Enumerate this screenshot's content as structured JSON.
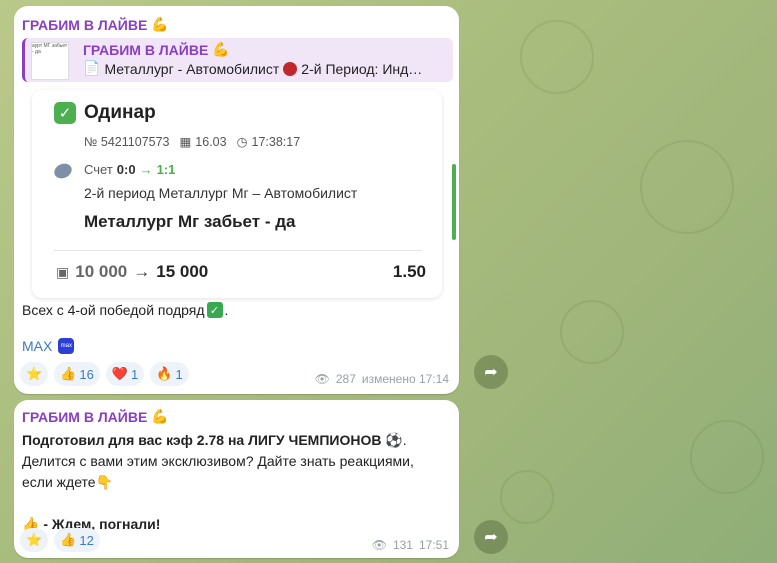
{
  "background": {
    "accent": "#8a3fc2",
    "link": "#3b79c4"
  },
  "message1": {
    "channel": "ГРАБИМ В ЛАЙВЕ",
    "reply": {
      "channel": "ГРАБИМ В ЛАЙВЕ",
      "text": "Металлург - Автомобилист",
      "text2": "2-й Период: Инд…",
      "thumb_caption": "аурт МГ забьет - да"
    },
    "card": {
      "title": "Одинар",
      "id": "№ 5421107573",
      "date": "16.03",
      "time": "17:38:17",
      "score_label": "Счет",
      "score_before": "0:0",
      "score_after": "1:1",
      "event": "2-й период Металлург Мг – Автомобилист",
      "bet": "Металлург Мг забьет - да",
      "stake": "10 000",
      "payout": "15 000",
      "odds": "1.50"
    },
    "text": "Всех с 4-ой победой подряд",
    "link": "MAX",
    "link_badge": "max",
    "reactions": [
      {
        "emoji": "⭐",
        "count": ""
      },
      {
        "emoji": "👍",
        "count": "16"
      },
      {
        "emoji": "❤️",
        "count": "1"
      },
      {
        "emoji": "🔥",
        "count": "1"
      }
    ],
    "views": "287",
    "edited": "изменено 17:14"
  },
  "message2": {
    "channel": "ГРАБИМ В ЛАЙВЕ",
    "line1": "Подготовил для вас кэф 2.78 на ЛИГУ ЧЕМПИОНОВ",
    "line2": "Делится с вами этим эксклюзивом? Дайте знать реакциями,",
    "line3": "если ждете",
    "line4": "- Ждем, погнали!",
    "reactions": [
      {
        "emoji": "⭐",
        "count": ""
      },
      {
        "emoji": "👍",
        "count": "12"
      }
    ],
    "views": "131",
    "time": "17:51"
  }
}
